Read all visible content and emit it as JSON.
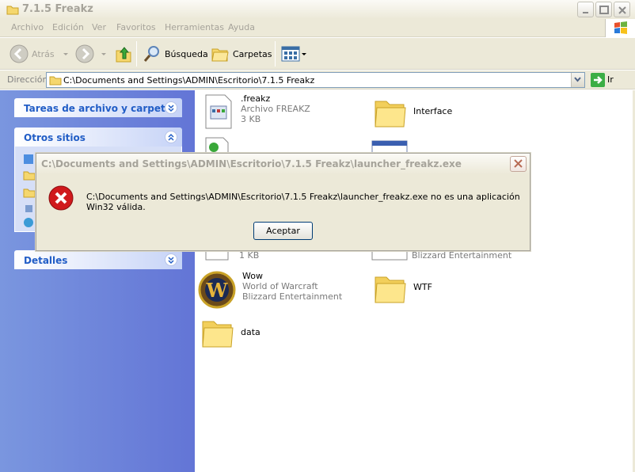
{
  "window": {
    "title": "7.1.5 Freakz"
  },
  "menu": [
    "Archivo",
    "Edición",
    "Ver",
    "Favoritos",
    "Herramientas",
    "Ayuda"
  ],
  "toolbar": {
    "back": "Atrás",
    "search": "Búsqueda",
    "folders": "Carpetas"
  },
  "address": {
    "label": "Dirección",
    "value": "C:\\Documents and Settings\\ADMIN\\Escritorio\\7.1.5 Freakz",
    "go": "Ir"
  },
  "sidebar": {
    "tasks": "Tareas de archivo y carpeta",
    "other": "Otros sitios",
    "details": "Detalles"
  },
  "files": [
    {
      "name": ".freakz",
      "type": "Archivo FREAKZ",
      "size": "3 KB"
    },
    {
      "name": "Interface"
    },
    {
      "size": "1 KB"
    },
    {
      "sub": "Blizzard Entertainment"
    },
    {
      "name": "Wow",
      "type": "World of Warcraft",
      "company": "Blizzard Entertainment"
    },
    {
      "name": "WTF"
    },
    {
      "name": "data"
    }
  ],
  "dialog": {
    "title": "C:\\Documents and Settings\\ADMIN\\Escritorio\\7.1.5 Freakz\\launcher_freakz.exe",
    "message": "C:\\Documents and Settings\\ADMIN\\Escritorio\\7.1.5 Freakz\\launcher_freakz.exe no es una aplicación Win32 válida.",
    "ok": "Aceptar"
  }
}
